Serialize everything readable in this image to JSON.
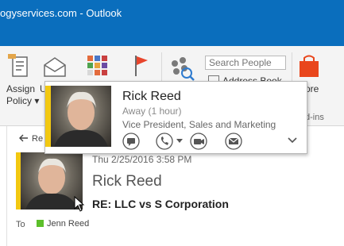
{
  "window": {
    "title": "ogyservices.com - Outlook"
  },
  "ribbon": {
    "assign_policy": "Assign\nPolicy ▾",
    "cut_label": "U",
    "search_people_placeholder": "Search People",
    "address_book": "Address Book",
    "more_label": "ore",
    "addins_label": "d-ins"
  },
  "contact_card": {
    "name": "Rick Reed",
    "status": "Away (1 hour)",
    "job_title": "Vice President, Sales and Marketing"
  },
  "message": {
    "reply_label": "Re",
    "date": "Thu 2/25/2016 3:58 PM",
    "sender": "Rick Reed",
    "subject": "RE: LLC vs S Corporation",
    "to_label": "To",
    "recipient": "Jenn Reed"
  },
  "colors": {
    "title_bar": "#0a6ebd",
    "availability_away": "#f2c811",
    "presence_online": "#5cbf2a",
    "flag": "#e8452c",
    "store_icon": "#e9461c"
  }
}
